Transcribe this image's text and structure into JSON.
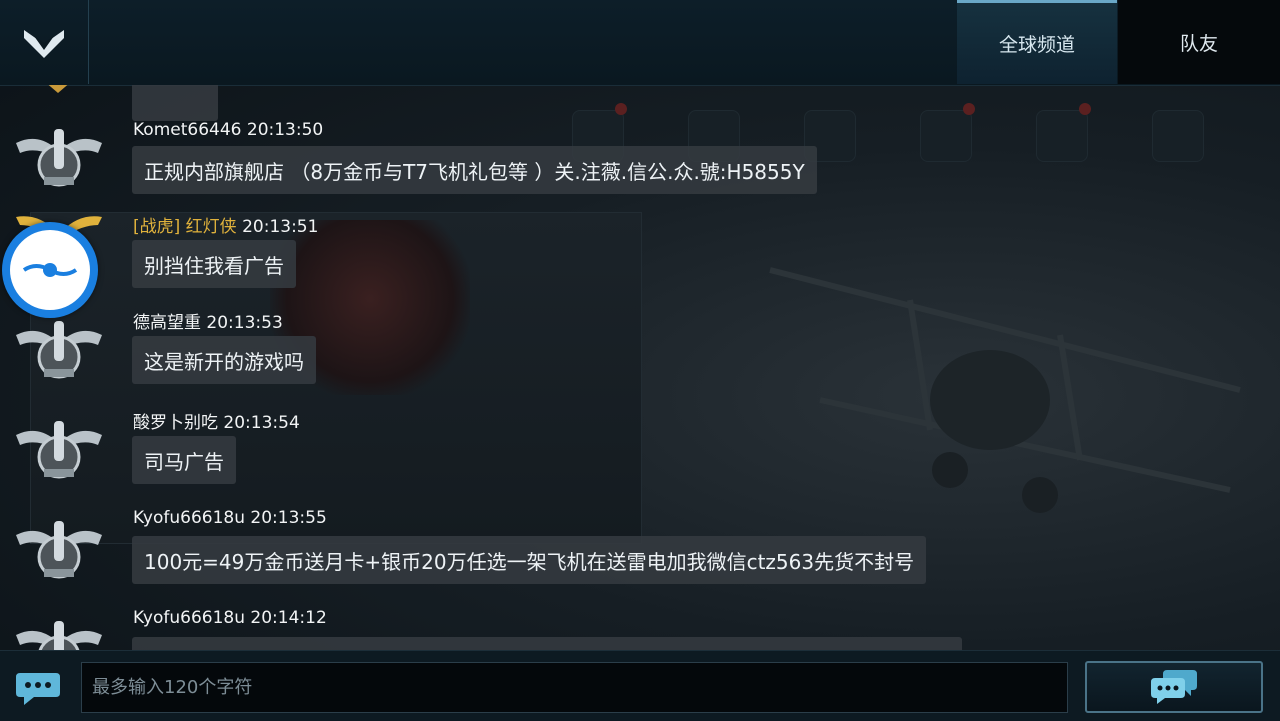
{
  "header": {
    "tabs": [
      {
        "label": "全球频道",
        "active": true
      },
      {
        "label": "队友",
        "active": false
      }
    ]
  },
  "messages": [
    {
      "name": "Komet66446",
      "time": "20:13:50",
      "text": "正规内部旗舰店 （8万金币与T7飞机礼包等 ）关.注薇.信公.众.號:H5855Y"
    },
    {
      "prefix": "[战虎] 红灯侠",
      "time": "20:13:51",
      "text": "别挡住我看广告"
    },
    {
      "name": "德高望重",
      "time": "20:13:53",
      "text": "这是新开的游戏吗"
    },
    {
      "name": "酸罗卜别吃",
      "time": "20:13:54",
      "text": "司马广告"
    },
    {
      "name": "Kyofu66618u",
      "time": "20:13:55",
      "text": "100元=49万金币送月卡+银币20万任选一架飞机在送雷电加我微信ctz563先货不封号"
    },
    {
      "name": "Kyofu66618u",
      "time": "20:14:12",
      "text": ""
    }
  ],
  "input": {
    "placeholder": "最多输入120个字符",
    "value": ""
  },
  "colors": {
    "header_bg": "#0d1e29",
    "bubble_bg": "#343a40",
    "vip_name": "#e0b23c",
    "float_ball": "#1a7fe0",
    "send_icon": "#7fd0ea"
  },
  "icons": [
    "chevron-down-logo-icon",
    "rank-badge-icon",
    "winged-badge-icon",
    "chat-bubble-icon",
    "send-chat-icon",
    "floating-assistant-icon"
  ]
}
